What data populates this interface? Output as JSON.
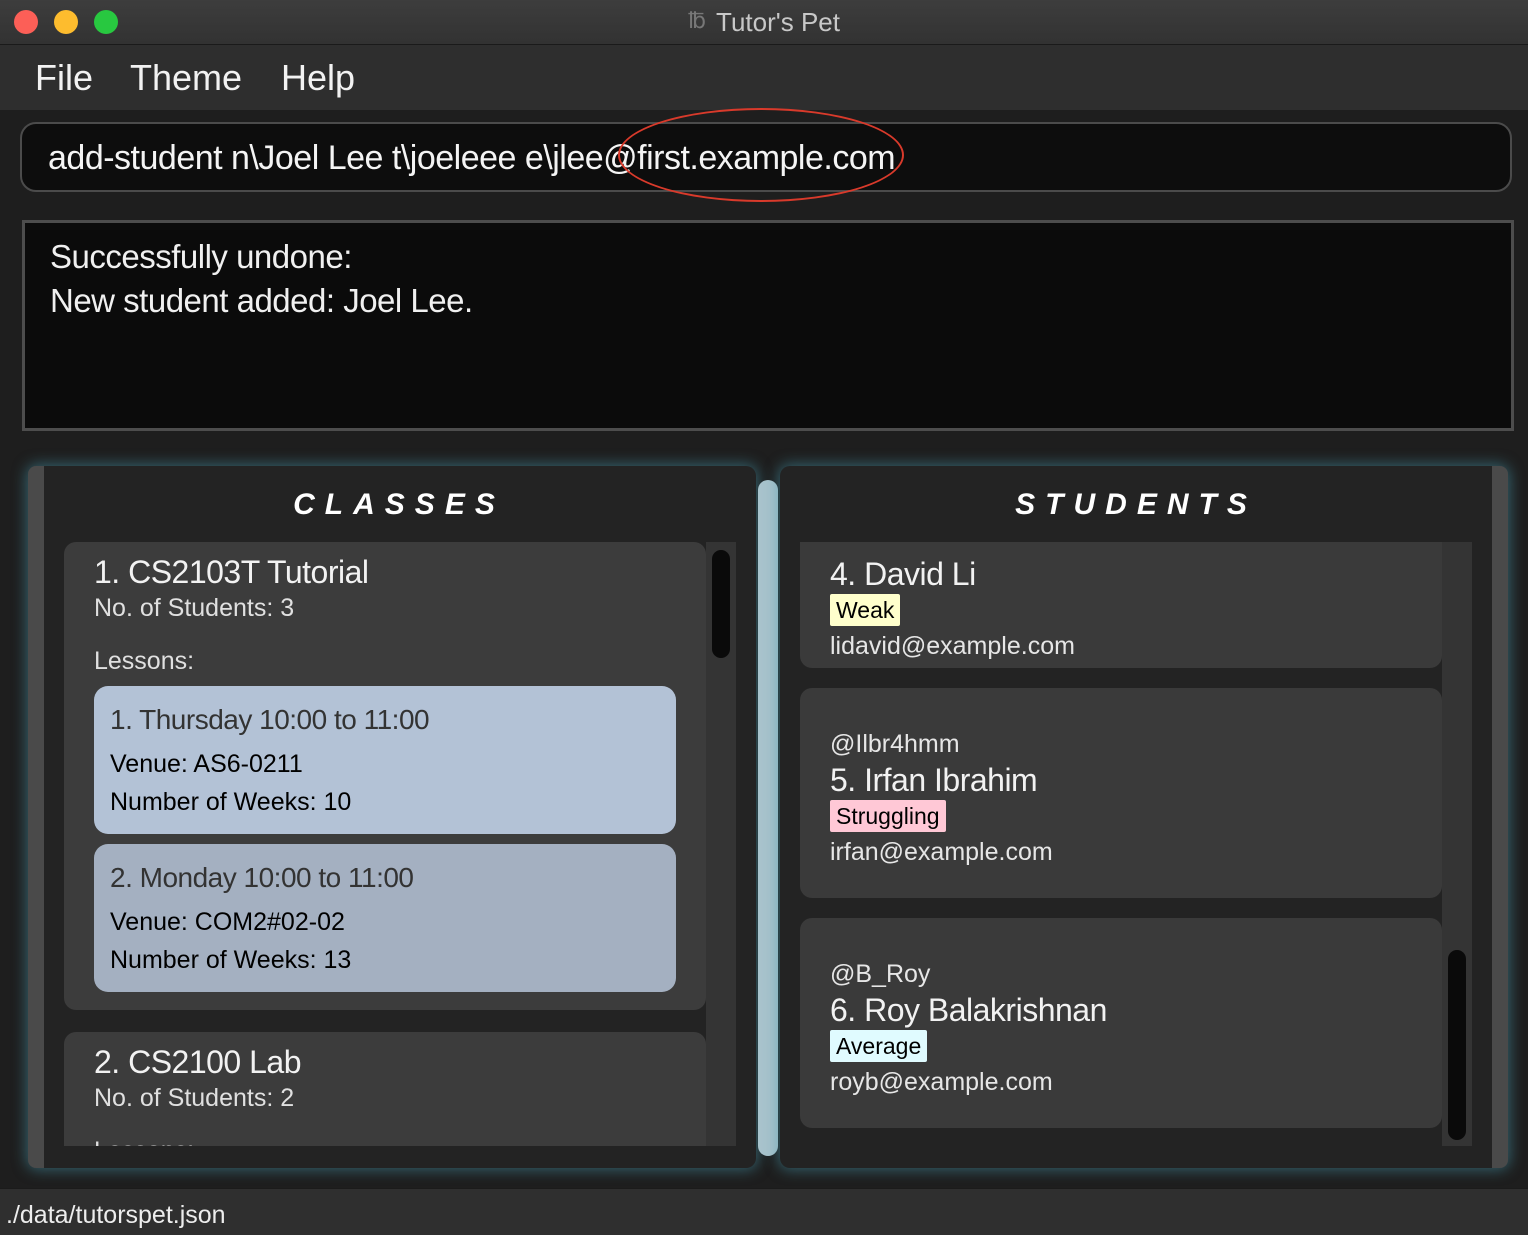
{
  "window": {
    "title": "Tutor's Pet",
    "icon": "tutors-pet-logo"
  },
  "menubar": {
    "file": "File",
    "theme": "Theme",
    "help": "Help"
  },
  "command_box": {
    "value": "add-student n\\Joel Lee t\\joeleee e\\jlee@first.example.com"
  },
  "result_display": {
    "line1": "Successfully undone:",
    "line2": "New student added: Joel Lee."
  },
  "classes_panel": {
    "header": "CLASSES",
    "items": [
      {
        "title": "1.  CS2103T Tutorial",
        "count": "No. of Students:  3",
        "lessons_label": "Lessons:",
        "lessons": [
          {
            "heading": "1. Thursday 10:00 to 11:00",
            "venue": "Venue: AS6-0211",
            "weeks": "Number of Weeks: 10"
          },
          {
            "heading": "2. Monday 10:00 to 11:00",
            "venue": "Venue: COM2#02-02",
            "weeks": "Number of Weeks: 13"
          }
        ]
      },
      {
        "title": "2.  CS2100 Lab",
        "count": "No. of Students:  2",
        "lessons_label": "Lessons:"
      }
    ]
  },
  "students_panel": {
    "header": "STUDENTS",
    "items": [
      {
        "telegram": "",
        "name": "4.  David Li",
        "tag": "Weak",
        "tag_color": "#ffffcc",
        "email": "lidavid@example.com"
      },
      {
        "telegram": "@Ilbr4hmm",
        "name": "5.  Irfan Ibrahim",
        "tag": "Struggling",
        "tag_color": "#ffc8d6",
        "email": "irfan@example.com"
      },
      {
        "telegram": "@B_Roy",
        "name": "6.  Roy Balakrishnan",
        "tag": "Average",
        "tag_color": "#e0fbff",
        "email": "royb@example.com"
      }
    ]
  },
  "statusbar": {
    "path": "./data/tutorspet.json"
  },
  "annotation": {
    "color": "#d93a2b"
  }
}
